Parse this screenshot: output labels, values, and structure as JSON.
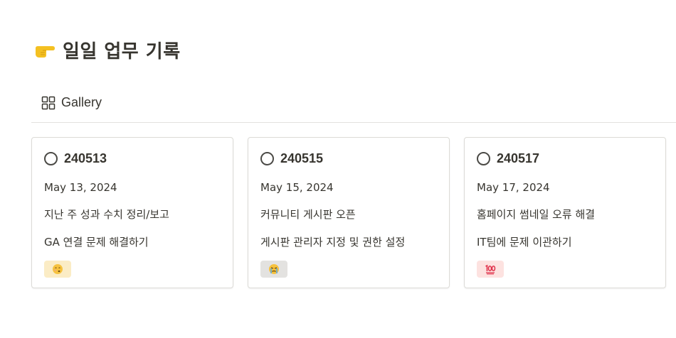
{
  "page": {
    "title": "일일 업무 기록",
    "title_icon": "pointing-hand-icon"
  },
  "view": {
    "label": "Gallery",
    "icon": "gallery-grid-icon"
  },
  "cards": [
    {
      "title": "240513",
      "date": "May 13, 2024",
      "line1": "지난 주 성과 수치 정리/보고",
      "line2": "GA 연결 문제 해결하기",
      "tag_icon": "face-emoji",
      "tag_color": "#fbecc5"
    },
    {
      "title": "240515",
      "date": "May 15, 2024",
      "line1": "커뮤니티 게시판 오픈",
      "line2": "게시판 관리자 지정 및 권한 설정",
      "tag_icon": "crying-face-emoji",
      "tag_color": "#e3e2e0"
    },
    {
      "title": "240517",
      "date": "May 17, 2024",
      "line1": "홈페이지 썸네일 오류 해결",
      "line2": "IT팀에 문제 이관하기",
      "tag_icon": "hundred-points-emoji",
      "tag_color": "#fde2e0"
    }
  ],
  "colors": {
    "text": "#37352f",
    "border": "#dcdbd7",
    "divider": "#e3e2df",
    "hand": "#f4c021"
  }
}
